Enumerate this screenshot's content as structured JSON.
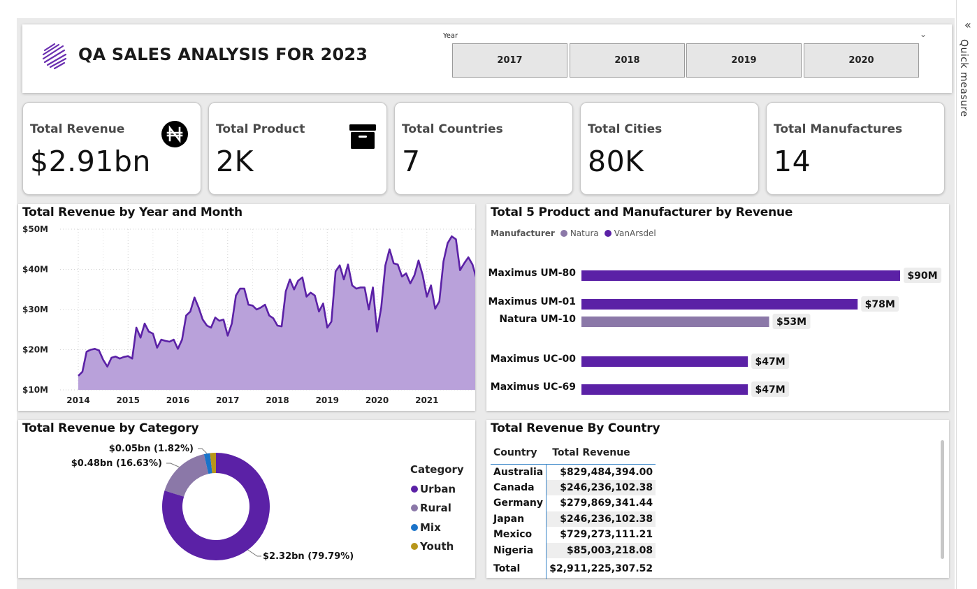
{
  "header": {
    "title": "QA SALES ANALYSIS FOR 2023",
    "year_label": "Year",
    "years": [
      "2017",
      "2018",
      "2019",
      "2020"
    ]
  },
  "kpis": [
    {
      "label": "Total Revenue",
      "value": "$2.91bn",
      "icon": "naira-icon"
    },
    {
      "label": "Total Product",
      "value": "2K",
      "icon": "archive-box-icon"
    },
    {
      "label": "Total Countries",
      "value": "7"
    },
    {
      "label": "Total Cities",
      "value": "80K"
    },
    {
      "label": "Total Manufactures",
      "value": "14"
    }
  ],
  "quick_measure": "Quick measure",
  "colors": {
    "accent": "#5b21a6",
    "area_fill": "#b9a1da",
    "natura": "#8b78a8",
    "mix": "#1a73c9",
    "youth": "#b8961a"
  },
  "chart_data": [
    {
      "type": "area",
      "title": "Total Revenue by Year and Month",
      "ytick_labels": [
        "$10M",
        "$20M",
        "$30M",
        "$40M",
        "$50M"
      ],
      "xtick_labels": [
        "2014",
        "2015",
        "2016",
        "2017",
        "2018",
        "2019",
        "2020",
        "2021"
      ],
      "ylim": [
        10,
        50
      ],
      "unit": "$M",
      "x_start": 2014,
      "values": [
        13.5,
        14.5,
        19.5,
        20,
        20.2,
        19.8,
        17.5,
        15.8,
        18,
        18.3,
        17.8,
        18.2,
        18.4,
        17.8,
        25.5,
        23,
        26.5,
        24.5,
        24,
        20.5,
        22.5,
        22.2,
        22,
        22.5,
        20.2,
        22.5,
        28.5,
        29.5,
        33,
        30.5,
        27.5,
        26,
        25.5,
        28,
        27.2,
        27.5,
        23.5,
        26.5,
        33.5,
        35.2,
        35.2,
        31.2,
        31,
        30,
        30.5,
        31.2,
        28.5,
        27.8,
        26,
        25.8,
        34.5,
        37.5,
        35,
        37.2,
        38,
        33.2,
        34.2,
        33.5,
        29.5,
        31.5,
        25.5,
        27,
        39.5,
        41,
        37.5,
        41.2,
        36,
        35.2,
        35.5,
        35.5,
        30,
        35.5,
        24.5,
        30.5,
        41,
        45,
        41.5,
        41.2,
        38.2,
        39,
        36.5,
        38.5,
        42.2,
        38.5,
        33.2,
        36,
        30.2,
        32,
        42,
        46.5,
        48.2,
        47.5,
        39.8,
        41.5,
        43,
        41.2,
        37.5,
        37.8
      ]
    },
    {
      "type": "bar",
      "title": "Total 5 Product and Manufacturer by Revenue",
      "legend_title": "Manufacturer",
      "legend": [
        "Natura",
        "VanArsdel"
      ],
      "categories": [
        "Maximus UM-80",
        "Maximus UM-01",
        "Natura UM-10",
        "Maximus UC-00",
        "Maximus UC-69"
      ],
      "values": [
        90,
        78,
        53,
        47,
        47
      ],
      "value_labels": [
        "$90M",
        "$78M",
        "$53M",
        "$47M",
        "$47M"
      ],
      "series_of": [
        "VanArsdel",
        "VanArsdel",
        "Natura",
        "VanArsdel",
        "VanArsdel"
      ],
      "unit": "$M"
    },
    {
      "type": "pie",
      "title": "Total Revenue by Category",
      "legend_title": "Category",
      "categories": [
        "Urban",
        "Rural",
        "Mix",
        "Youth"
      ],
      "values": [
        79.79,
        16.63,
        1.82,
        1.76
      ],
      "labels": [
        "$2.32bn (79.79%)",
        "$0.48bn (16.63%)",
        "$0.05bn (1.82%)"
      ]
    },
    {
      "type": "table",
      "title": "Total Revenue By Country",
      "columns": [
        "Country",
        "Total Revenue"
      ],
      "rows": [
        [
          "Australia",
          "$829,484,394.00"
        ],
        [
          "Canada",
          "$246,236,102.38"
        ],
        [
          "Germany",
          "$279,869,341.44"
        ],
        [
          "Japan",
          "$246,236,102.38"
        ],
        [
          "Mexico",
          "$729,273,111.21"
        ],
        [
          "Nigeria",
          "$85,003,218.08"
        ]
      ],
      "total": [
        "Total",
        "$2,911,225,307.52"
      ]
    }
  ]
}
